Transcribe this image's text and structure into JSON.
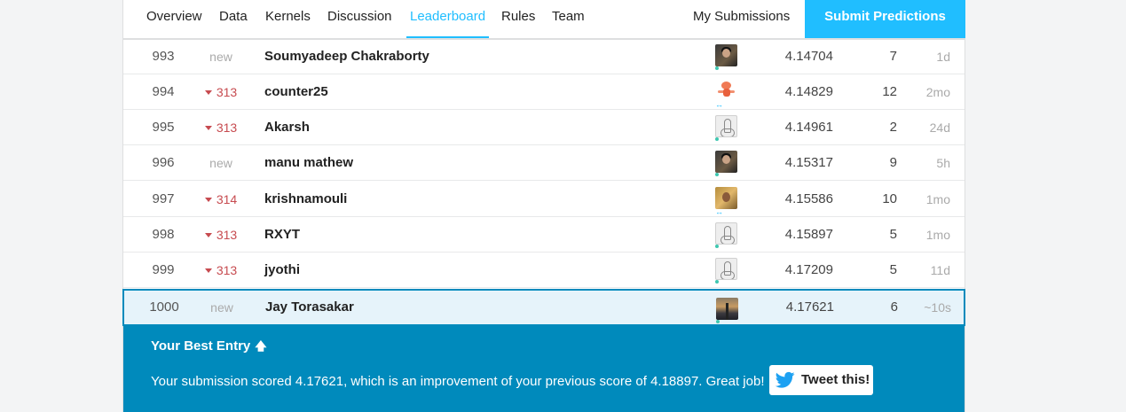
{
  "nav": {
    "tabs": [
      {
        "label": "Overview"
      },
      {
        "label": "Data"
      },
      {
        "label": "Kernels"
      },
      {
        "label": "Discussion"
      },
      {
        "label": "Leaderboard"
      },
      {
        "label": "Rules"
      },
      {
        "label": "Team"
      }
    ],
    "active_tab": "Leaderboard",
    "my_submissions": "My Submissions",
    "submit_label": "Submit Predictions"
  },
  "leaderboard": {
    "rows": [
      {
        "rank": "993",
        "move": "new",
        "name": "Soumyadeep Chakraborty",
        "score": "4.14704",
        "entries": "7",
        "last": "1d"
      },
      {
        "rank": "994",
        "move": "313",
        "name": "counter25",
        "score": "4.14829",
        "entries": "12",
        "last": "2mo"
      },
      {
        "rank": "995",
        "move": "313",
        "name": "Akarsh",
        "score": "4.14961",
        "entries": "2",
        "last": "24d"
      },
      {
        "rank": "996",
        "move": "new",
        "name": "manu mathew",
        "score": "4.15317",
        "entries": "9",
        "last": "5h"
      },
      {
        "rank": "997",
        "move": "314",
        "name": "krishnamouli",
        "score": "4.15586",
        "entries": "10",
        "last": "1mo"
      },
      {
        "rank": "998",
        "move": "313",
        "name": "RXYT",
        "score": "4.15897",
        "entries": "5",
        "last": "1mo"
      },
      {
        "rank": "999",
        "move": "313",
        "name": "jyothi",
        "score": "4.17209",
        "entries": "5",
        "last": "11d"
      },
      {
        "rank": "1000",
        "move": "new",
        "name": "Jay Torasakar",
        "score": "4.17621",
        "entries": "6",
        "last": "~10s"
      }
    ]
  },
  "best_entry": {
    "title": "Your Best Entry",
    "arrow": "🡅",
    "message": "Your submission scored 4.17621, which is an improvement of your previous score of 4.18897. Great job!",
    "tweet_label": "Tweet this!"
  },
  "colors": {
    "accent": "#20beff",
    "best_entry_bg": "#008abc",
    "rank_down": "#c74b50",
    "highlight_row": "#e6f3fa"
  }
}
